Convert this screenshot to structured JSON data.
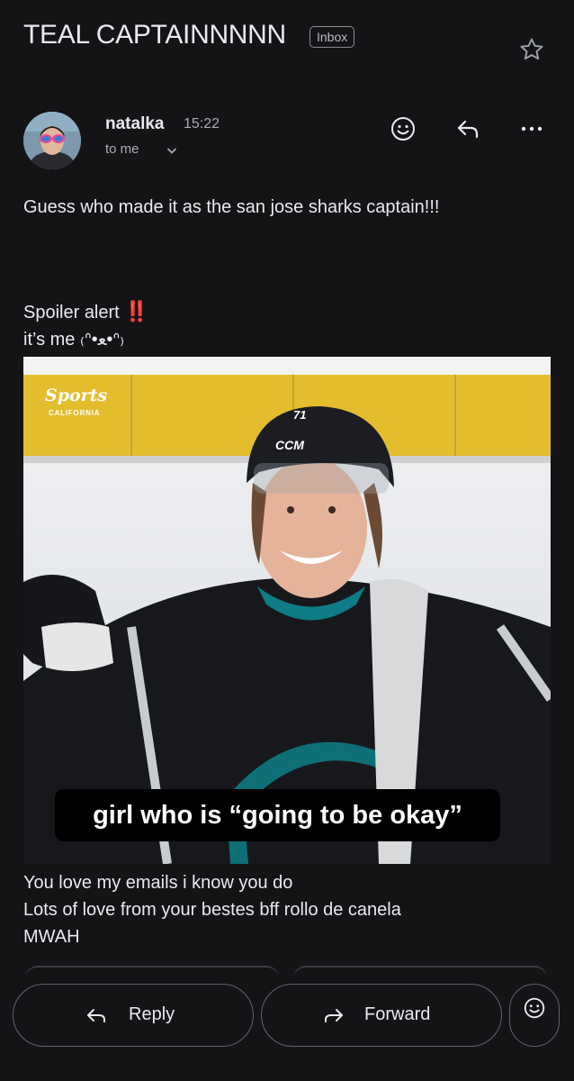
{
  "email": {
    "subject": "TEAL CAPTAINNNNN",
    "label": "Inbox",
    "sender": "natalka",
    "time": "15:22",
    "recipient": "to me",
    "body_lines": [
      "Guess who made it as the san jose sharks captain!!!",
      "Spoiler alert",
      "it’s me ₍ᐢ•ﻌ•ᐢ₎",
      "You love my emails i know you do",
      "Lots of love from your bestes bff rollo de canela",
      "MWAH"
    ],
    "spoiler_mark": "‼️"
  },
  "image": {
    "logo_text": "Sports",
    "logo_subtext": "CALIFORNIA",
    "helmet_brand": "CCM",
    "helmet_number": "71",
    "caption": "girl who is “going to be okay”"
  },
  "actions": {
    "reply": "Reply",
    "forward": "Forward"
  },
  "icons": [
    "star-icon",
    "emoji-react-icon",
    "reply-icon",
    "more-icon",
    "chevron-down-icon",
    "forward-icon"
  ],
  "colors": {
    "background": "#141416",
    "text": "#e8eaed",
    "muted": "#a8abaf",
    "red": "#e0221e"
  }
}
